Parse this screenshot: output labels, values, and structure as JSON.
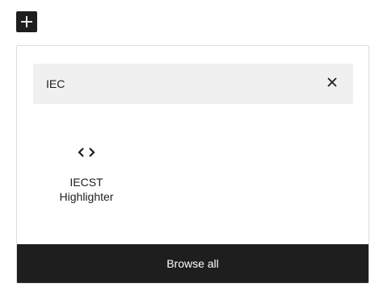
{
  "inserter": {
    "toggle_icon": "plus-icon",
    "search": {
      "value": "IEC",
      "clear_icon": "close-icon"
    },
    "results": [
      {
        "icon": "code-brackets-icon",
        "title": "IECST Highlighter"
      }
    ],
    "browse_all_label": "Browse all"
  },
  "colors": {
    "dark": "#1e1e1e",
    "search_bg": "#f0f0f0",
    "border": "#dddddd"
  }
}
